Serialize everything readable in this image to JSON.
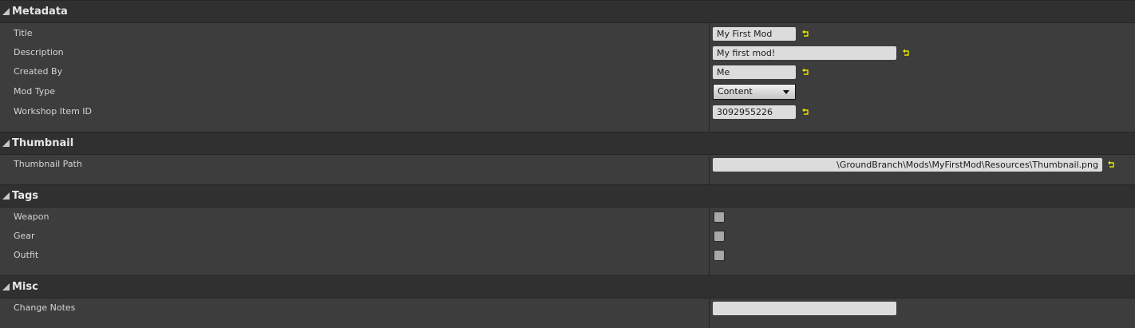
{
  "metadata": {
    "title": "Metadata",
    "fields": {
      "title": {
        "label": "Title",
        "value": "My First Mod"
      },
      "description": {
        "label": "Description",
        "value": "My first mod!"
      },
      "created_by": {
        "label": "Created By",
        "value": "Me"
      },
      "mod_type": {
        "label": "Mod Type",
        "value": "Content"
      },
      "workshop_item_id": {
        "label": "Workshop Item ID",
        "value": "3092955226"
      }
    }
  },
  "thumbnail": {
    "title": "Thumbnail",
    "path": {
      "label": "Thumbnail Path",
      "value": "\\GroundBranch\\Mods\\MyFirstMod\\Resources\\Thumbnail.png"
    }
  },
  "tags": {
    "title": "Tags",
    "items": [
      {
        "label": "Weapon",
        "checked": false
      },
      {
        "label": "Gear",
        "checked": false
      },
      {
        "label": "Outfit",
        "checked": false
      }
    ]
  },
  "misc": {
    "title": "Misc",
    "change_notes": {
      "label": "Change Notes",
      "value": ""
    }
  },
  "icons": {
    "collapse": "collapse-triangle-icon",
    "reset": "reset-to-default-icon"
  },
  "colors": {
    "reset_icon": "#e6e600",
    "panel_bg": "#3d3d3d",
    "category_bg": "#303030",
    "field_bg": "#dcdcdc"
  }
}
